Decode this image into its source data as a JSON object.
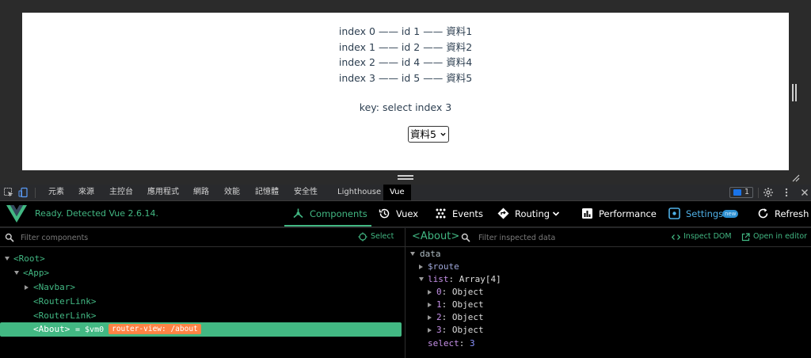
{
  "page": {
    "items": [
      "index 0 —— id 1 —— 資料1",
      "index 1 —— id 2 —— 資料2",
      "index 2 —— id 4 —— 資料4",
      "index 3 —— id 5 —— 資料5"
    ],
    "key_line": "key: select index 3",
    "select_value": "資料5"
  },
  "devtools_tabs": [
    "元素",
    "來源",
    "主控台",
    "應用程式",
    "網路",
    "效能",
    "記憶體",
    "安全性",
    "Lighthouse",
    "Vue"
  ],
  "active_tab": "Vue",
  "issues_count": "1",
  "vue": {
    "status": "Ready. Detected Vue 2.6.14.",
    "toolbar": {
      "components": "Components",
      "vuex": "Vuex",
      "events": "Events",
      "routing": "Routing",
      "performance": "Performance",
      "settings": "Settings",
      "new_badge": "new",
      "refresh": "Refresh"
    }
  },
  "components_panel": {
    "filter_placeholder": "Filter components",
    "select_label": "Select",
    "tree": [
      {
        "label": "<Root>",
        "depth": 0,
        "arrow": "down"
      },
      {
        "label": "<App>",
        "depth": 1,
        "arrow": "down"
      },
      {
        "label": "<Navbar>",
        "depth": 2,
        "arrow": "right"
      },
      {
        "label": "<RouterLink>",
        "depth": 2,
        "arrow": ""
      },
      {
        "label": "<RouterLink>",
        "depth": 2,
        "arrow": ""
      },
      {
        "label": "<About>",
        "depth": 2,
        "arrow": "",
        "selected": true,
        "vm": "= $vm0",
        "badge": "router-view: /about"
      }
    ]
  },
  "inspector": {
    "title": "<About>",
    "filter_placeholder": "Filter inspected data",
    "inspect_dom": "Inspect DOM",
    "open_editor": "Open in editor",
    "section": "data",
    "route_key": "$route",
    "list_key": "list",
    "list_value": "Array[4]",
    "list_items": [
      {
        "key": "0",
        "value": "Object"
      },
      {
        "key": "1",
        "value": "Object"
      },
      {
        "key": "2",
        "value": "Object"
      },
      {
        "key": "3",
        "value": "Object"
      }
    ],
    "select_key": "select",
    "select_value": "3"
  },
  "colors": {
    "vue_green": "#42b883",
    "settings_blue": "#4fb0e6",
    "badge_orange": "#ff8344",
    "panel_bg": "#000000"
  }
}
